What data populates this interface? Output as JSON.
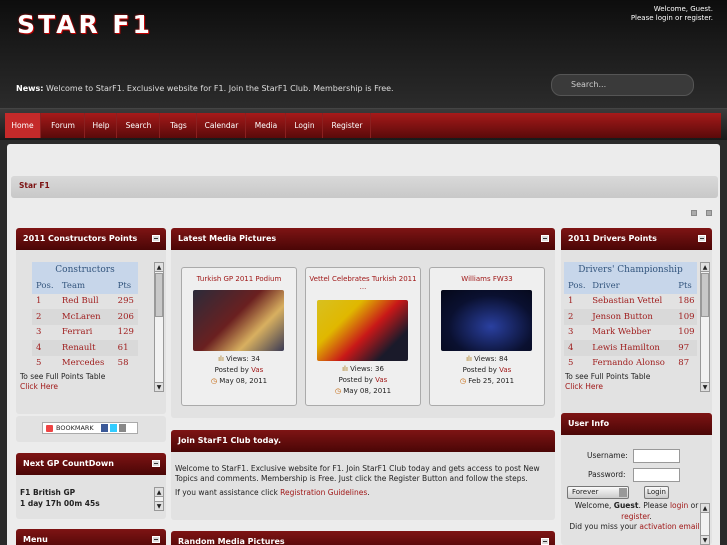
{
  "header": {
    "logo": "STAR F1",
    "welcome_line1": "Welcome, Guest.",
    "welcome_line2": "Please login or register.",
    "news_label": "News:",
    "news_text": "Welcome to StarF1. Exclusive website for F1. Join the StarF1 Club. Membership is Free.",
    "search_placeholder": "Search..."
  },
  "nav": [
    "Home",
    "Forum",
    "Help",
    "Search",
    "Tags",
    "Calendar",
    "Media",
    "Login",
    "Register"
  ],
  "breadcrumb": "Star F1",
  "constructors": {
    "title": "2011 Constructors Points",
    "table_title": "Constructors",
    "columns": [
      "Pos.",
      "Team",
      "Pts"
    ],
    "rows": [
      [
        "1",
        "Red Bull",
        "295"
      ],
      [
        "2",
        "McLaren",
        "206"
      ],
      [
        "3",
        "Ferrari",
        "129"
      ],
      [
        "4",
        "Renault",
        "61"
      ],
      [
        "5",
        "Mercedes",
        "58"
      ]
    ],
    "footer1": "To see Full Points Table",
    "footer2": "Click Here"
  },
  "drivers": {
    "title": "2011 Drivers Points",
    "table_title": "Drivers' Championship",
    "columns": [
      "Pos.",
      "Driver",
      "Pts"
    ],
    "rows": [
      [
        "1",
        "Sebastian Vettel",
        "186"
      ],
      [
        "2",
        "Jenson Button",
        "109"
      ],
      [
        "3",
        "Mark Webber",
        "109"
      ],
      [
        "4",
        "Lewis Hamilton",
        "97"
      ],
      [
        "5",
        "Fernando Alonso",
        "87"
      ]
    ],
    "footer1": "To see Full Points Table",
    "footer2": "Click Here"
  },
  "media": {
    "title": "Latest Media Pictures",
    "cards": [
      {
        "title": "Turkish GP 2011 Podium",
        "title2": "",
        "views": "Views: 34",
        "posted_by": "Posted by",
        "poster": "Vas",
        "date": "May 08, 2011"
      },
      {
        "title": "Vettel Celebrates Turkish 2011",
        "title2": "...",
        "views": "Views: 36",
        "posted_by": "Posted by",
        "poster": "Vas",
        "date": "May 08, 2011"
      },
      {
        "title": "Williams FW33",
        "title2": "",
        "views": "Views: 84",
        "posted_by": "Posted by",
        "poster": "Vas",
        "date": "Feb 25, 2011"
      }
    ]
  },
  "bookmark": "BOOKMARK",
  "countdown": {
    "title": "Next GP CountDown",
    "race": "F1 British GP",
    "time": "1 day 17h 00m 45s"
  },
  "menu": {
    "title": "Menu"
  },
  "club": {
    "title": "Join StarF1 Club today.",
    "text1": "Welcome to StarF1. Exclusive website for F1. Join StarF1 Club today and gets access to post New Topics and comments. Membership is Free. Just click the Register Button and follow the steps.",
    "text2_prefix": "If you want assistance click ",
    "text2_link": "Registration Guidelines",
    "text2_suffix": "."
  },
  "random": {
    "title": "Random Media Pictures"
  },
  "userinfo": {
    "title": "User Info",
    "username_label": "Username:",
    "password_label": "Password:",
    "duration": "Forever",
    "login_button": "Login",
    "welcome_prefix": "Welcome, ",
    "welcome_name": "Guest",
    "welcome_mid": ". Please ",
    "login_link": "login",
    "or": " or",
    "register_link": "register",
    "register_suffix": ".",
    "missed_prefix": "Did you miss your ",
    "missed_link": "activation email",
    "missed_suffix": "?"
  }
}
